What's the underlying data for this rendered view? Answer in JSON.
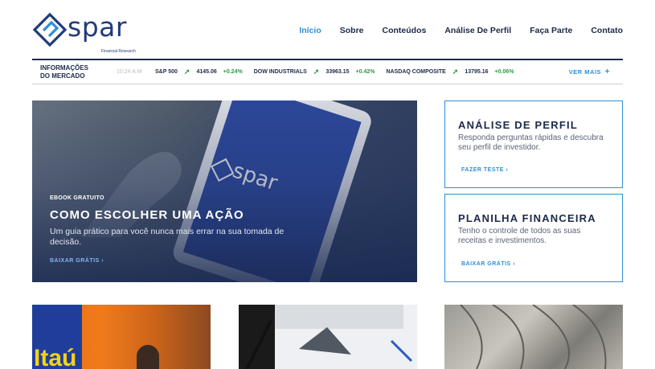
{
  "brand": {
    "name": "spar",
    "tagline": "Financial Research"
  },
  "nav": [
    {
      "label": "Início",
      "active": true
    },
    {
      "label": "Sobre",
      "active": false
    },
    {
      "label": "Conteúdos",
      "active": false
    },
    {
      "label": "Análise De Perfil",
      "active": false
    },
    {
      "label": "Faça Parte",
      "active": false
    },
    {
      "label": "Contato",
      "active": false
    }
  ],
  "ticker": {
    "label_line1": "INFORMAÇÕES",
    "label_line2": "DO MERCADO",
    "time": "10:24 A.M",
    "items": [
      {
        "name": "S&P 500",
        "value": "4145.06",
        "change": "+0.24%"
      },
      {
        "name": "DOW INDUSTRIALS",
        "value": "33963.15",
        "change": "+0.42%"
      },
      {
        "name": "NASDAQ COMPOSITE",
        "value": "13795.16",
        "change": "+0.06%"
      }
    ],
    "more": "VER MAIS"
  },
  "hero": {
    "device_logo": "spar",
    "kicker": "EBOOK GRATUITO",
    "title": "COMO ESCOLHER UMA AÇÃO",
    "description": "Um guia prático para você nunca mais errar na sua tomada de decisão.",
    "cta": "BAIXAR GRÁTIS"
  },
  "cards": [
    {
      "title": "ANÁLISE DE PERFIL",
      "description": "Responda perguntas rápidas e descubra seu perfil de investidor.",
      "cta": "FAZER TESTE"
    },
    {
      "title": "PLANILHA FINANCEIRA",
      "description": "Tenho o controle de todos as suas receitas e investimentos.",
      "cta": "BAIXAR GRÁTIS"
    }
  ],
  "thumbs": {
    "brand_partial": "Itaú"
  },
  "colors": {
    "navy": "#1c2a4a",
    "accent": "#2c8fd6",
    "positive": "#2e9a46"
  }
}
